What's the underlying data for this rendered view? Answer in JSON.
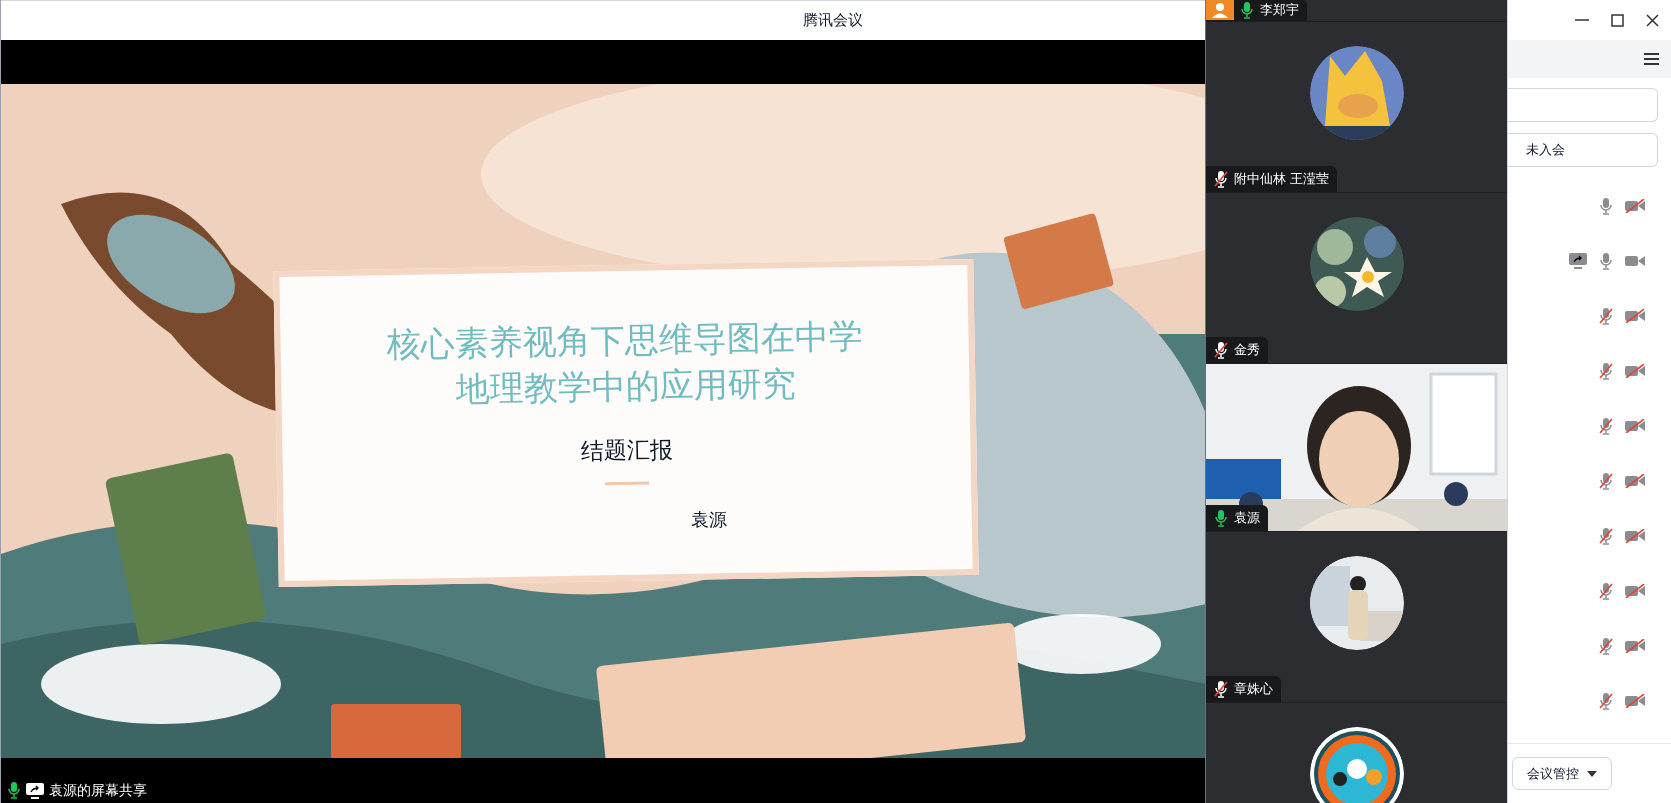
{
  "window": {
    "title": "腾讯会议"
  },
  "slide": {
    "title_lines": [
      "核心素养视角下思维导图在中学",
      "地理教学中的应用研究"
    ],
    "subtitle": "结题汇报",
    "author": "袁源"
  },
  "share_bar": {
    "mic_on": true,
    "label": "袁源的屏幕共享"
  },
  "video_panel": {
    "top_label": {
      "name": "李郑宇",
      "host": true,
      "mic_on": true
    },
    "tiles": [
      {
        "kind": "avatar",
        "name": "附中仙林 王滢莹",
        "mic_on": false
      },
      {
        "kind": "avatar",
        "name": "金秀",
        "mic_on": false
      },
      {
        "kind": "video",
        "name": "袁源",
        "mic_on": true
      },
      {
        "kind": "avatar",
        "name": "章姝心",
        "mic_on": false
      },
      {
        "kind": "avatar"
      }
    ]
  },
  "members_panel": {
    "filter": "未入会",
    "participants": [
      {
        "sharing": false,
        "mic_on": true,
        "camera_on": false
      },
      {
        "sharing": true,
        "mic_on": true,
        "camera_on": true
      },
      {
        "sharing": false,
        "mic_on": false,
        "camera_on": false
      },
      {
        "sharing": false,
        "mic_on": false,
        "camera_on": false
      },
      {
        "sharing": false,
        "mic_on": false,
        "camera_on": false
      },
      {
        "sharing": false,
        "mic_on": false,
        "camera_on": false
      },
      {
        "sharing": false,
        "mic_on": false,
        "camera_on": false
      },
      {
        "sharing": false,
        "mic_on": false,
        "camera_on": false
      },
      {
        "sharing": false,
        "mic_on": false,
        "camera_on": false
      },
      {
        "sharing": false,
        "mic_on": false,
        "camera_on": false
      }
    ],
    "button": "会议管控"
  }
}
